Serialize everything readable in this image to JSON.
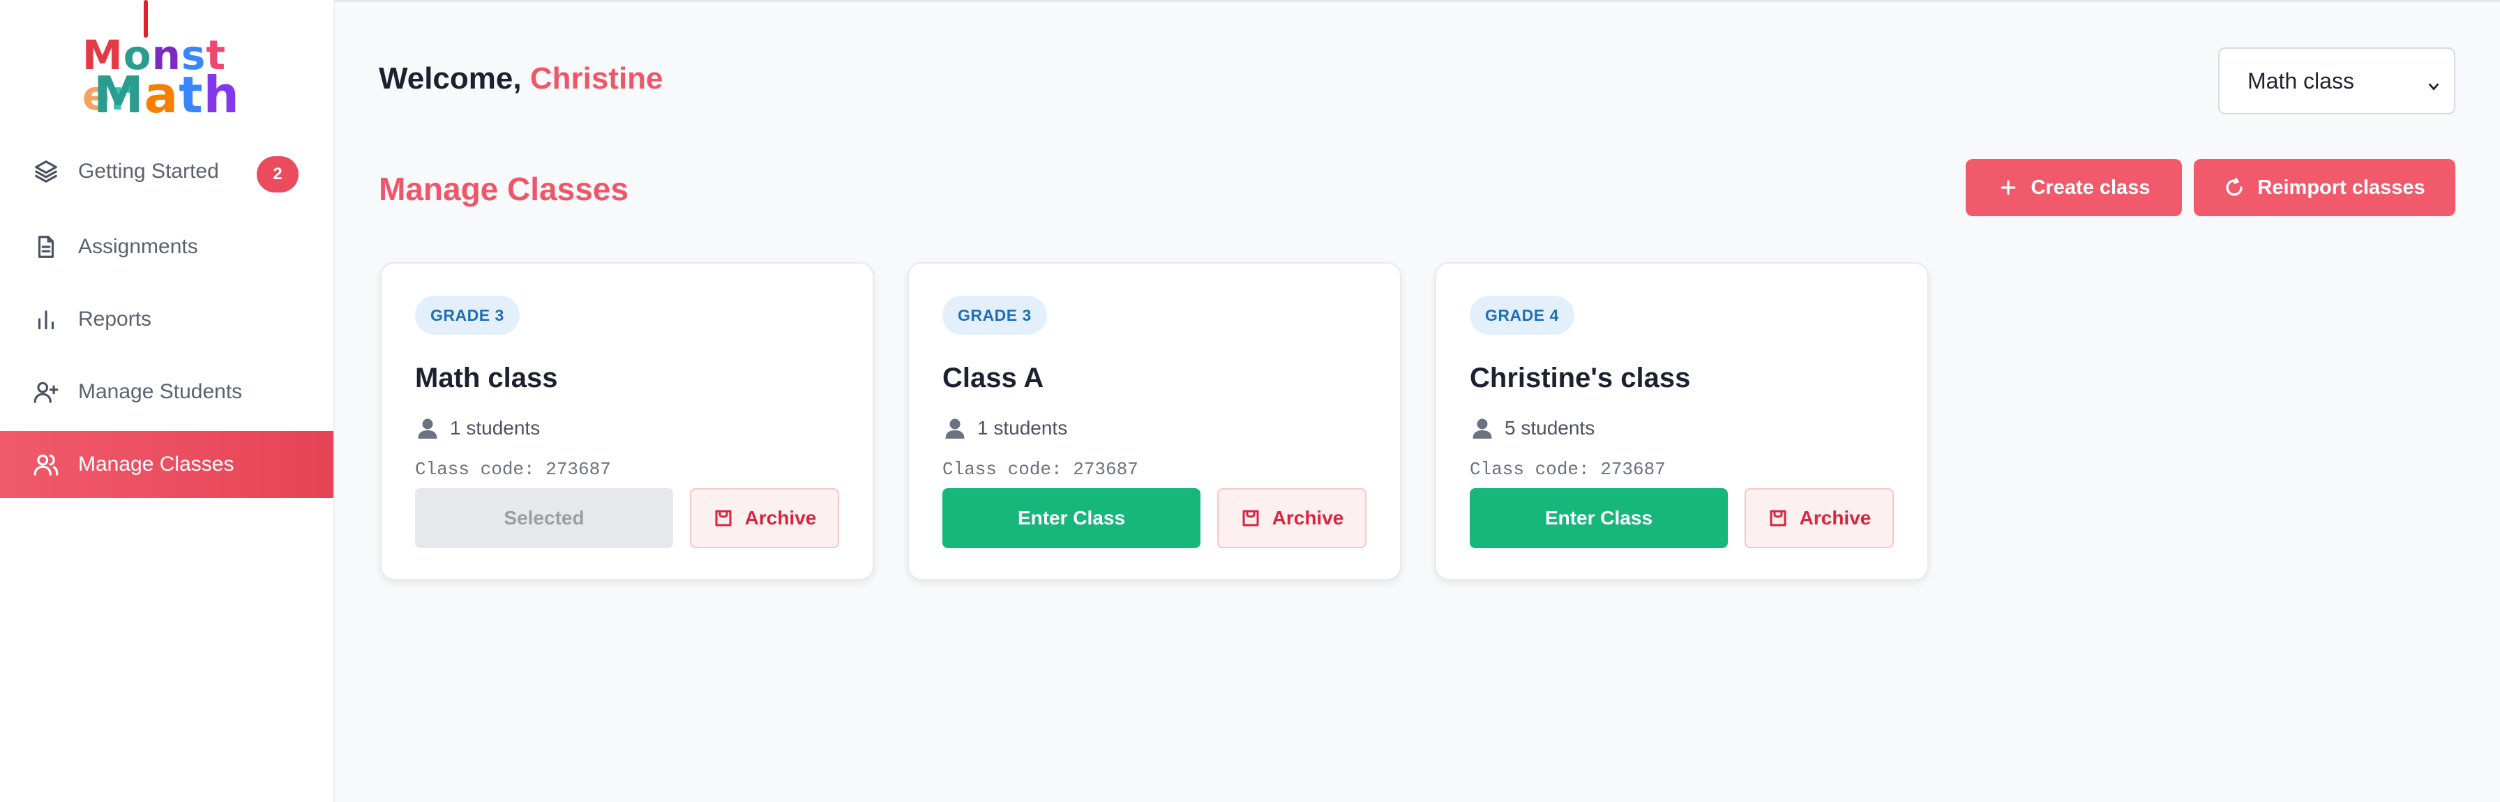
{
  "brand": {
    "logo_top": "Monster",
    "logo_bottom": "Math",
    "logo_colors_top": [
      "#e63946",
      "#2a9d8f",
      "#7b2cbf",
      "#3a86ff",
      "#ef476f",
      "#f4a261",
      "#2ec4b6"
    ],
    "logo_colors_bottom": [
      "#2a9d8f",
      "#f77f00",
      "#3a86ff",
      "#8338ec"
    ]
  },
  "sidebar": {
    "items": [
      {
        "label": "Getting Started",
        "icon": "layers-icon",
        "badge": "2"
      },
      {
        "label": "Assignments",
        "icon": "document-icon"
      },
      {
        "label": "Reports",
        "icon": "bar-chart-icon"
      },
      {
        "label": "Manage Students",
        "icon": "user-plus-icon"
      },
      {
        "label": "Manage Classes",
        "icon": "users-icon",
        "active": true
      }
    ]
  },
  "header": {
    "welcome_prefix": "Welcome, ",
    "user_name": "Christine",
    "class_select_value": "Math class"
  },
  "section": {
    "title": "Manage Classes",
    "create_label": "Create class",
    "reimport_label": "Reimport classes"
  },
  "cards": [
    {
      "grade": "GRADE 3",
      "name": "Math class",
      "students": "1 students",
      "code": "Class code: 273687",
      "primary_label": "Selected",
      "archive_label": "Archive"
    },
    {
      "grade": "GRADE 3",
      "name": "Class A",
      "students": "1 students",
      "code": "Class code: 273687",
      "primary_label": "Enter Class",
      "archive_label": "Archive"
    },
    {
      "grade": "GRADE 4",
      "name": "Christine's class",
      "students": "5 students",
      "code": "Class code: 273687",
      "primary_label": "Enter Class",
      "archive_label": "Archive"
    }
  ],
  "colors": {
    "accent": "#ef5768",
    "success": "#17b77b",
    "grade_badge_bg": "#e3f0fc",
    "archive_text": "#d7263d"
  }
}
